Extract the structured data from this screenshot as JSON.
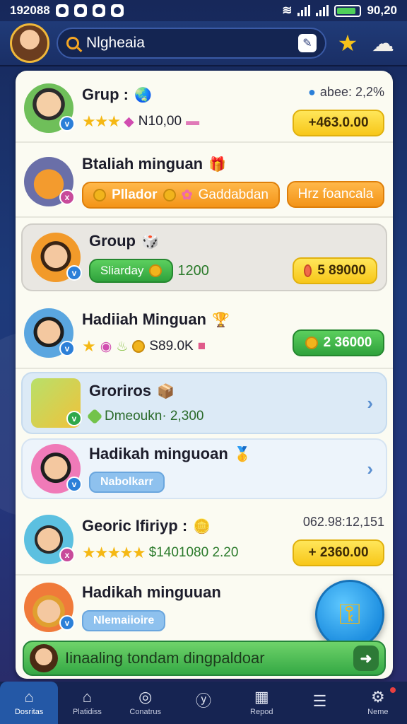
{
  "status": {
    "time": "192088",
    "right_text": "90,20",
    "battery_level": 0.85
  },
  "header": {
    "search_value": "Nlgheaia"
  },
  "rows": [
    {
      "title": "Grup :",
      "meta": "abee: 2,2%",
      "line": "N10,00",
      "pill": "+463.0.00",
      "badge": "v"
    },
    {
      "title": "Btaliah minguan",
      "pill_left": "Pllador",
      "pill_left_sub": "Gaddabdan",
      "pill_right": "Hrz foancala",
      "badge": "x"
    },
    {
      "title": "Group",
      "pill_left": "Sliarday",
      "pill_left_value": "1200",
      "pill": "5 89000",
      "badge": "v"
    },
    {
      "title": "Hadiiah Minguan",
      "line": "S89.0K",
      "pill": "2 36000",
      "badge": "v"
    },
    {
      "title": "Groriros",
      "line": "Dmeoukn· 2,300",
      "badge": "v"
    },
    {
      "title": "Hadikah minguoan",
      "tag": "Nabolkarr",
      "badge": "v"
    },
    {
      "title": "Georic Ifiriyp :",
      "meta": "062.98:12,151",
      "line": "$1401080 2.20",
      "pill": "+ 2360.00",
      "badge": "x"
    },
    {
      "title": "Hadikah minguuan",
      "tag": "Nlemaiioire",
      "badge": "v"
    }
  ],
  "banner": {
    "text": "Iinaaling tondam dingpaldoar"
  },
  "tabs": [
    {
      "label": "Dosritas",
      "icon": "home-icon"
    },
    {
      "label": "Platidiss",
      "icon": "house-icon"
    },
    {
      "label": "Conatrus",
      "icon": "compass-icon"
    },
    {
      "label": "",
      "icon": "filter-icon"
    },
    {
      "label": "Repod",
      "icon": "calendar-icon"
    },
    {
      "label": "",
      "icon": "chat-icon"
    },
    {
      "label": "Neme",
      "icon": "gear-icon"
    }
  ],
  "colors": {
    "accent": "#2458a6",
    "yellow": "#f7c719",
    "green": "#34a844",
    "orange": "#f39418"
  }
}
